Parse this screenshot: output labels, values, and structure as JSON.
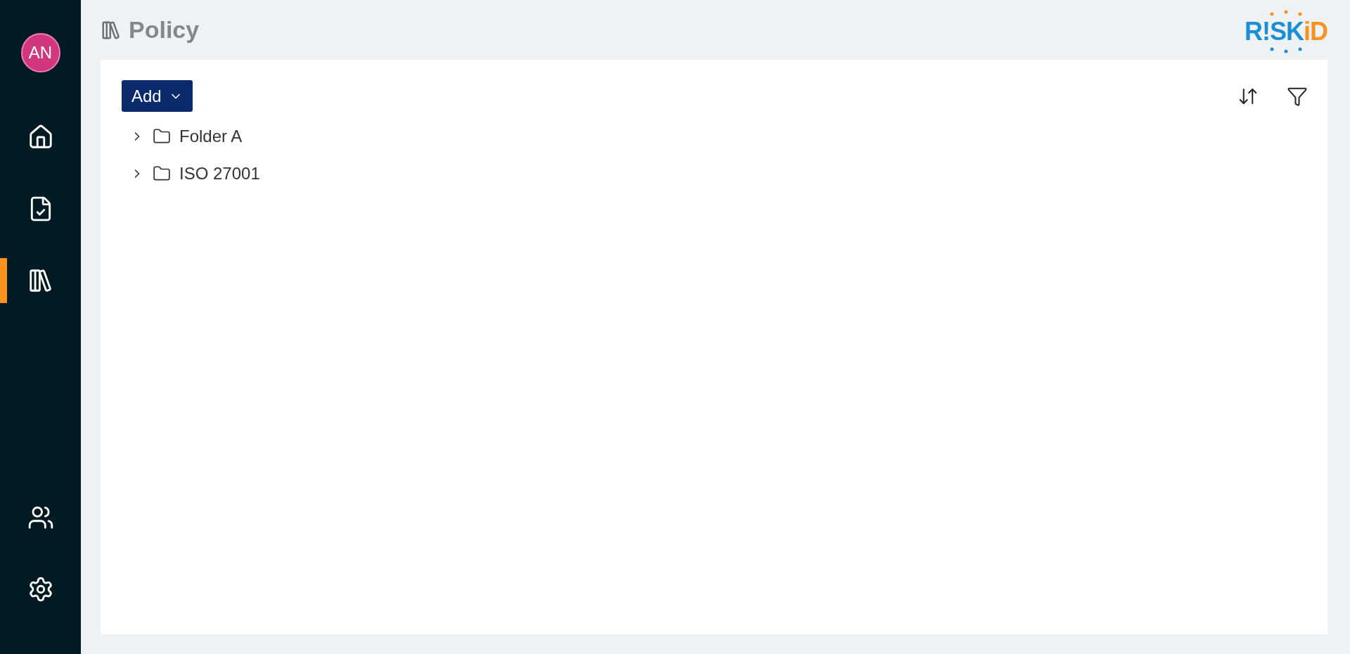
{
  "user": {
    "initials": "AN"
  },
  "sidebar": {
    "items": [
      {
        "kind": "home",
        "selected": false
      },
      {
        "kind": "document",
        "selected": false
      },
      {
        "kind": "library",
        "selected": true
      }
    ],
    "bottom_items": [
      {
        "kind": "users",
        "selected": false
      },
      {
        "kind": "settings",
        "selected": false
      }
    ]
  },
  "header": {
    "title": "Policy"
  },
  "logo": {
    "prefix": "R!SK",
    "suffix": "iD"
  },
  "toolbar": {
    "add_button": "Add"
  },
  "tree": [
    {
      "label": "Folder A",
      "expanded": false
    },
    {
      "label": "ISO 27001",
      "expanded": false
    }
  ]
}
